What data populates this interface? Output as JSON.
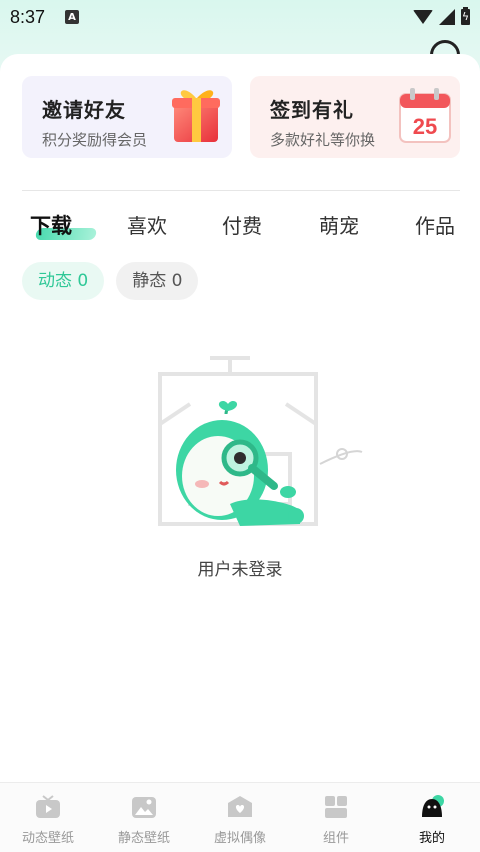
{
  "status_bar": {
    "time": "8:37",
    "notification_badge": "A"
  },
  "promos": [
    {
      "title": "邀请好友",
      "subtitle": "积分奖励得会员",
      "icon": "gift-icon"
    },
    {
      "title": "签到有礼",
      "subtitle": "多款好礼等你换",
      "icon": "calendar-icon",
      "calendar_day": "25"
    }
  ],
  "tabs": [
    {
      "label": "下载",
      "active": true
    },
    {
      "label": "喜欢"
    },
    {
      "label": "付费"
    },
    {
      "label": "萌宠"
    },
    {
      "label": "作品"
    }
  ],
  "chips": [
    {
      "label": "动态 0",
      "active": true
    },
    {
      "label": "静态 0",
      "active": false
    }
  ],
  "empty_state": {
    "message": "用户未登录"
  },
  "bottom_nav": [
    {
      "label": "动态壁纸",
      "icon": "tv-play-icon"
    },
    {
      "label": "静态壁纸",
      "icon": "image-icon"
    },
    {
      "label": "虚拟偶像",
      "icon": "heart-box-icon"
    },
    {
      "label": "组件",
      "icon": "widgets-icon"
    },
    {
      "label": "我的",
      "icon": "avatar-icon",
      "active": true
    }
  ],
  "colors": {
    "accent": "#2fc897",
    "chip_active_bg": "#e9f9f3"
  }
}
